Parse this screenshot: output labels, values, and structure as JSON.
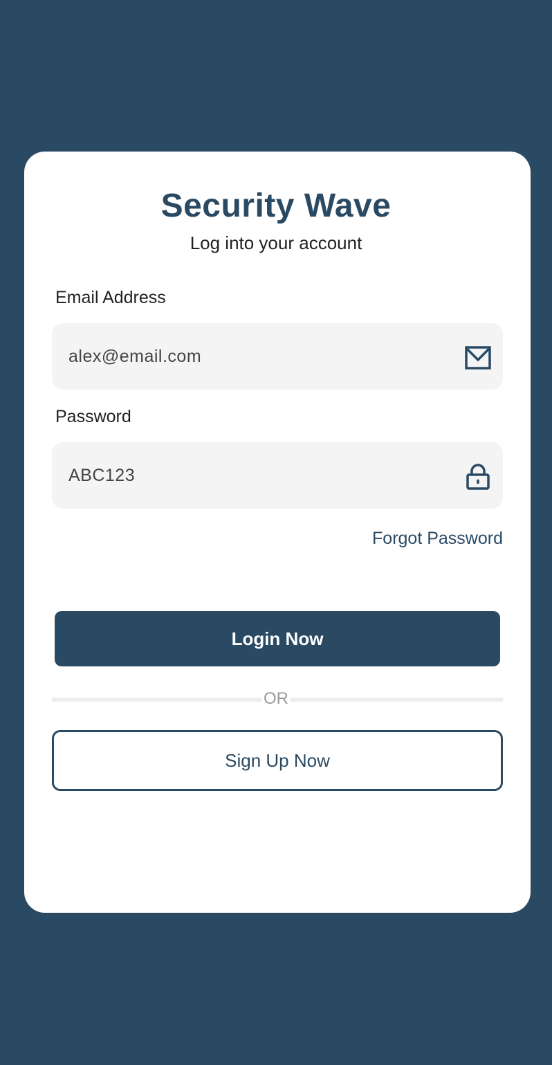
{
  "app": {
    "title": "Security Wave",
    "subtitle": "Log into your account"
  },
  "form": {
    "email": {
      "label": "Email Address",
      "value": "alex@email.com",
      "icon": "envelope-icon"
    },
    "password": {
      "label": "Password",
      "value": "ABC123",
      "icon": "lock-icon"
    },
    "forgot_label": "Forgot Password",
    "login_label": "Login Now",
    "divider_label": "OR",
    "signup_label": "Sign Up Now"
  },
  "colors": {
    "primary": "#2a4a64",
    "card": "#ffffff",
    "input_bg": "#f4f4f4",
    "divider": "#eeeeee",
    "muted_text": "#999999"
  }
}
